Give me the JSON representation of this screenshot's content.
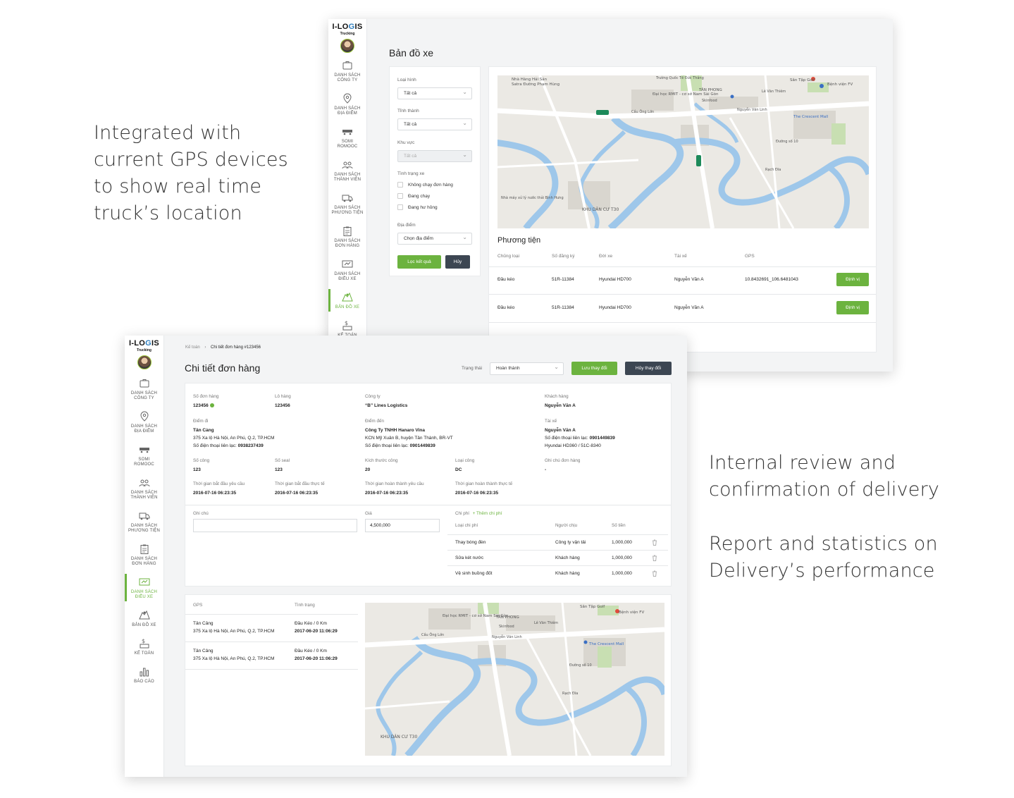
{
  "captions": {
    "gps": [
      "Integrated with",
      "current GPS devices",
      "to show real time",
      "truck’s location"
    ],
    "review": [
      "Internal review and",
      "confirmation of delivery"
    ],
    "report": [
      "Report and statistics on",
      "Delivery’s performance"
    ]
  },
  "brand": {
    "logo_main_a": "I-LO",
    "logo_main_b": "G",
    "logo_main_c": "IS",
    "logo_sub": "Trucking"
  },
  "sidebar1": [
    {
      "line1": "DANH SÁCH",
      "line2": "CÔNG TY",
      "icon": "briefcase-icon"
    },
    {
      "line1": "DANH SÁCH",
      "line2": "ĐỊA ĐIỂM",
      "icon": "location-pin-icon"
    },
    {
      "line1": "SOMI",
      "line2": "ROMOOC",
      "icon": "trailer-icon"
    },
    {
      "line1": "DANH SÁCH",
      "line2": "THÀNH VIÊN",
      "icon": "users-icon"
    },
    {
      "line1": "DANH SÁCH",
      "line2": "PHƯƠNG TIỆN",
      "icon": "truck-icon"
    },
    {
      "line1": "DANH SÁCH",
      "line2": "ĐƠN HÀNG",
      "icon": "clipboard-icon"
    },
    {
      "line1": "DANH SÁCH",
      "line2": "ĐIỀU XE",
      "icon": "dispatch-icon"
    },
    {
      "line1": "BẢN ĐỒ XE",
      "line2": "",
      "icon": "map-icon"
    },
    {
      "line1": "KẾ TOÁN",
      "line2": "",
      "icon": "accounting-icon"
    }
  ],
  "sidebar2": [
    {
      "line1": "DANH SÁCH",
      "line2": "CÔNG TY",
      "icon": "briefcase-icon"
    },
    {
      "line1": "DANH SÁCH",
      "line2": "ĐỊA ĐIỂM",
      "icon": "location-pin-icon"
    },
    {
      "line1": "SOMI",
      "line2": "ROMOOC",
      "icon": "trailer-icon"
    },
    {
      "line1": "DANH SÁCH",
      "line2": "THÀNH VIÊN",
      "icon": "users-icon"
    },
    {
      "line1": "DANH SÁCH",
      "line2": "PHƯƠNG TIỆN",
      "icon": "truck-icon"
    },
    {
      "line1": "DANH SÁCH",
      "line2": "ĐƠN HÀNG",
      "icon": "clipboard-icon"
    },
    {
      "line1": "DANH SÁCH",
      "line2": "ĐIỀU XE",
      "icon": "dispatch-icon"
    },
    {
      "line1": "BẢN ĐỒ XE",
      "line2": "",
      "icon": "map-icon"
    },
    {
      "line1": "KẾ TOÁN",
      "line2": "",
      "icon": "accounting-icon"
    },
    {
      "line1": "BÁO CÁO",
      "line2": "",
      "icon": "report-icon"
    }
  ],
  "map_screen": {
    "title": "Bản đồ xe",
    "filter": {
      "type_label": "Loại hình",
      "type_value": "Tất cả",
      "city_label": "Tỉnh thành",
      "city_value": "Tất cả",
      "area_label": "Khu vực",
      "area_value": "Tất cả",
      "status_label": "Tình trạng xe",
      "status_options": [
        "Không chạy đơn hàng",
        "Đang chạy",
        "Đang hư hỏng"
      ],
      "place_label": "Địa điểm",
      "place_value": "Chọn địa điểm",
      "filter_btn": "Lọc kết quả",
      "cancel_btn": "Hủy"
    },
    "map_labels": {
      "a": "Nhà Hàng Hải Sản",
      "b": "Satra Đường Phạm Hùng",
      "c": "Đại học RMIT - cơ sở Nam Sài Gòn",
      "d": "Cầu Ông Lớn",
      "e": "TÂN PHONG",
      "f": "Sân Tập Golf",
      "g": "Bệnh viện FV",
      "h": "Nguyễn Văn Linh",
      "i": "The Crescent Mall",
      "j": "Skinfood",
      "k": "Lê Văn Thiêm",
      "l": "Trường Quốc Tế Đức Thắng",
      "m": "Nhà máy xử lý nước thải Bình Hưng",
      "n": "KHU DÂN CƯ T30",
      "o": "Rạch Đĩa",
      "p": "Đường số 10"
    },
    "vehicles": {
      "title": "Phương tiện",
      "headers": [
        "Chủng loại",
        "Số đăng ký",
        "Đời xe",
        "Tài xế",
        "GPS"
      ],
      "rows": [
        {
          "type": "Đầu kéo",
          "plate": "51R-11384",
          "model": "Hyundai HD700",
          "driver": "Nguyễn Văn A",
          "gps": "10.8432691_106.6481043",
          "action": "Định vị"
        },
        {
          "type": "Đầu kéo",
          "plate": "51R-11384",
          "model": "Hyundai HD700",
          "driver": "Nguyễn Văn A",
          "gps": "",
          "action": "Định vị"
        }
      ]
    }
  },
  "order_screen": {
    "breadcrumb_root": "Kế toán",
    "breadcrumb_sep": "›",
    "breadcrumb_current": "Chi tiết đơn hàng #123456",
    "title": "Chi tiết đơn hàng",
    "status_label": "Trạng thái",
    "status_value": "Hoàn thành",
    "save_btn": "Lưu thay đổi",
    "discard_btn": "Hủy thay đổi",
    "fields": {
      "order_no_label": "Số đơn hàng",
      "order_no": "123456",
      "lot_label": "Lô hàng",
      "lot": "123456",
      "company_label": "Công ty",
      "company": "“B” Lines Logistics",
      "customer_label": "Khách hàng",
      "customer": "Nguyễn Văn A",
      "from_label": "Điểm đi",
      "from_name": "Tân Cảng",
      "from_addr": "375 Xa lộ Hà Nội, An Phú, Q.2, TP.HCM",
      "from_phone_label": "Số điện thoại liên lạc:",
      "from_phone": "0938237439",
      "to_label": "Điểm đến",
      "to_name": "Công Ty TNHH Hanaro Vina",
      "to_addr": "KCN Mỹ Xuân B, huyện Tân Thành, BR-VT",
      "to_phone_label": "Số điện thoại liên lạc:",
      "to_phone": "0901449839",
      "driver_label": "Tài xế",
      "driver_name": "Nguyễn Văn A",
      "driver_phone_label": "Số điện thoại liên lạc:",
      "driver_phone": "0901449839",
      "driver_truck": "Hyundai HD360 / 51C-8340",
      "container_label": "Số công",
      "container": "123",
      "seal_label": "Số seal",
      "seal": "123",
      "size_label": "Kích thước công",
      "size": "20",
      "ctype_label": "Loại công",
      "ctype": "DC",
      "note_label": "Ghi chú đơn hàng",
      "note": "-",
      "t1_label": "Thời gian bắt đầu yêu cầu",
      "t1": "2016-07-16 06:23:35",
      "t2_label": "Thời gian bắt đầu thực tế",
      "t2": "2016-07-16 06:23:35",
      "t3_label": "Thời gian hoàn thành yêu cầu",
      "t3": "2016-07-16 06:23:35",
      "t4_label": "Thời gian hoàn thành thực tế",
      "t4": "2016-07-16 06:23:35"
    },
    "comment_label": "Ghi chú",
    "comment_value": "",
    "price_label": "Giá",
    "price_value": "4,500,000",
    "cost_label": "Chi phí",
    "add_cost": "+ Thêm chi phí",
    "cost_headers": [
      "Loại chi phí",
      "Người chịu",
      "Số tiền"
    ],
    "costs": [
      {
        "name": "Thay bóng đèn",
        "payer": "Công ty vận tải",
        "amount": "1,000,000"
      },
      {
        "name": "Sửa két nước",
        "payer": "Khách hàng",
        "amount": "1,000,000"
      },
      {
        "name": "Vệ sinh buồng đốt",
        "payer": "Khách hàng",
        "amount": "1,000,000"
      }
    ],
    "gps_headers": [
      "GPS",
      "Tình trạng"
    ],
    "gps_rows": [
      {
        "place": "Tân Cảng",
        "addr": "375 Xa lộ Hà Nội, An Phú, Q.2, TP.HCM",
        "status": "Đầu Kéo / 0 Km",
        "time": "2017-06-20 11:06:29"
      },
      {
        "place": "Tân Cảng",
        "addr": "375 Xa lộ Hà Nội, An Phú, Q.2, TP.HCM",
        "status": "Đầu Kéo / 0 Km",
        "time": "2017-06-20 11:06:29"
      }
    ]
  },
  "colors": {
    "accent": "#6cb33f",
    "dark_button": "#3c4652",
    "river": "#9ec7ea",
    "road": "#ffffff",
    "park": "#c8dfb2"
  }
}
